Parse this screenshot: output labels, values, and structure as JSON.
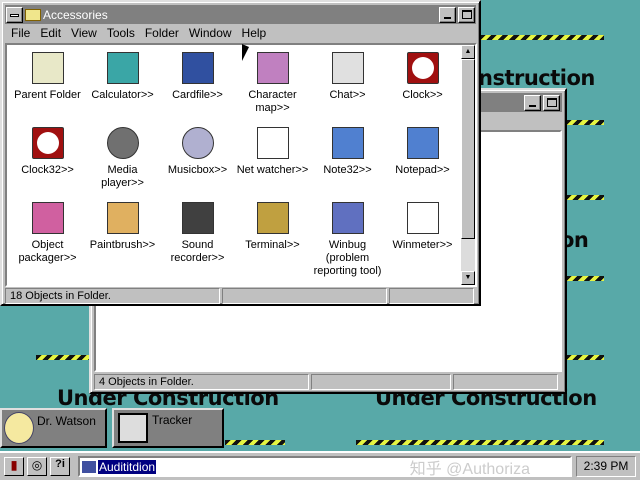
{
  "desktop": {
    "banner": "Under Construction",
    "banner_partial_1": "nstruction",
    "banner_partial_2": "on"
  },
  "accessories": {
    "title": "Accessories",
    "menu": [
      "File",
      "Edit",
      "View",
      "Tools",
      "Folder",
      "Window",
      "Help"
    ],
    "items": [
      {
        "label": "Parent Folder",
        "icon": "parent-folder-icon"
      },
      {
        "label": "Calculator>>",
        "icon": "calculator-icon"
      },
      {
        "label": "Cardfile>>",
        "icon": "cardfile-icon"
      },
      {
        "label": "Character map>>",
        "icon": "character-map-icon"
      },
      {
        "label": "Chat>>",
        "icon": "telephone-icon"
      },
      {
        "label": "Clock>>",
        "icon": "clock-icon"
      },
      {
        "label": "Clock32>>",
        "icon": "clock-icon"
      },
      {
        "label": "Media player>>",
        "icon": "film-reel-icon"
      },
      {
        "label": "Musicbox>>",
        "icon": "cd-icon"
      },
      {
        "label": "Net watcher>>",
        "icon": "document-icon"
      },
      {
        "label": "Note32>>",
        "icon": "notepad-icon"
      },
      {
        "label": "Notepad>>",
        "icon": "notepad-icon"
      },
      {
        "label": "Object packager>>",
        "icon": "packager-icon"
      },
      {
        "label": "Paintbrush>>",
        "icon": "palette-icon"
      },
      {
        "label": "Sound recorder>>",
        "icon": "microphone-icon"
      },
      {
        "label": "Terminal>>",
        "icon": "terminal-icon"
      },
      {
        "label": "Winbug (problem reporting tool)",
        "icon": "winbug-icon"
      },
      {
        "label": "Winmeter>>",
        "icon": "document-icon"
      }
    ],
    "status": "18 Objects in Folder."
  },
  "second_window": {
    "status": "4 Objects in Folder."
  },
  "minimized": [
    {
      "label": "Dr. Watson"
    },
    {
      "label": "Tracker"
    }
  ],
  "taskbar": {
    "field_value": "Audititdion",
    "clock": "2:39 PM"
  },
  "watermark": "知乎 @Authoriza"
}
